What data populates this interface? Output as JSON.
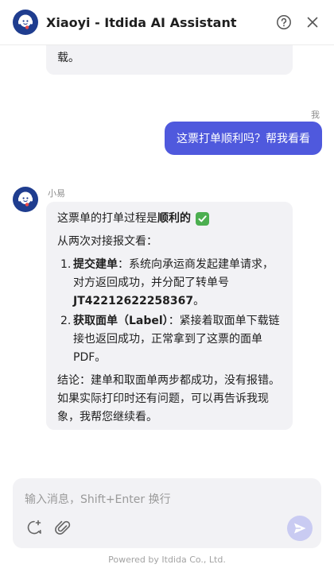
{
  "header": {
    "title": "Xiaoyi - Itdida AI Assistant",
    "avatar_icon": "ai-headset-avatar-icon",
    "help_icon": "help-circle-icon",
    "close_icon": "close-icon"
  },
  "messages": {
    "previous_ai_tail": "载。",
    "user_name": "我",
    "user_message": "这票打单顺利吗？帮我看看",
    "ai_name": "小易",
    "ai_answer": {
      "intro_prefix": "这票单的打单过程是",
      "intro_bold": "顺利的",
      "intro_emoji": "check-mark-icon",
      "line2": "从两次对接报文看：",
      "steps": [
        {
          "num": "1.",
          "bold": "提交建单",
          "text": "：系统向承运商发起建单请求，对方返回成功，并分配了转单号",
          "bold2": "JT42212622258367",
          "tail": "。"
        },
        {
          "num": "2.",
          "bold": "获取面单（Label）",
          "text": "：紧接着取面单下载链接也返回成功，正常拿到了这票的面单PDF。",
          "bold2": "",
          "tail": ""
        }
      ],
      "conclusion": "结论：建单和取面单两步都成功，没有报错。如果实际打印时还有问题，可以再告诉我现象，我帮您继续看。"
    }
  },
  "input": {
    "placeholder": "输入消息，Shift+Enter 换行",
    "new_chat_icon": "new-chat-icon",
    "attach_icon": "paperclip-icon",
    "send_icon": "send-icon"
  },
  "footer": {
    "text": "Powered by Itdida Co., Ltd."
  },
  "colors": {
    "accent": "#4f59dd",
    "send_disabled": "#c9cbf2",
    "bubble_bg": "#f2f2f5",
    "check_green": "#4caf50",
    "avatar_blue": "#1f3d8f"
  }
}
